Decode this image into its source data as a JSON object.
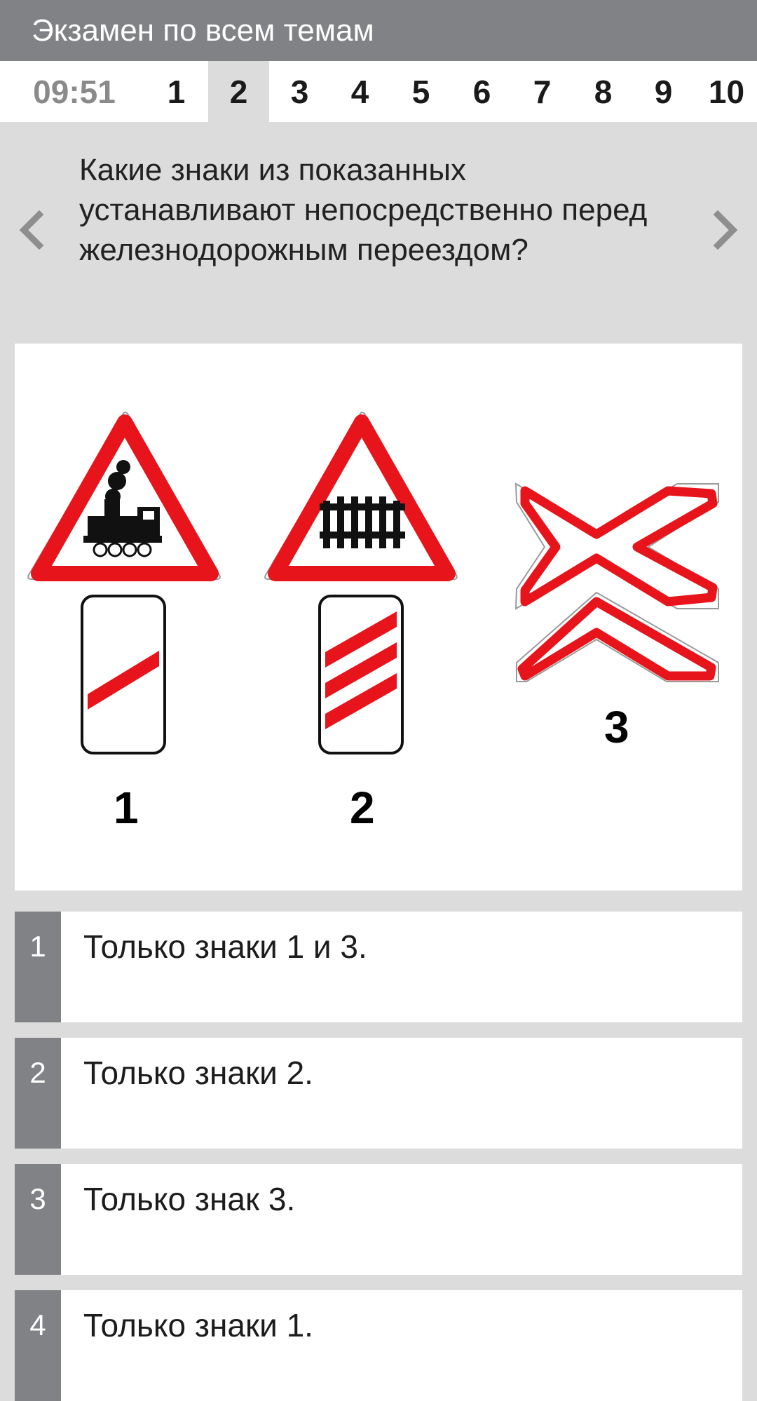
{
  "app_bar": {
    "title": "Экзамен по всем темам"
  },
  "tab_bar": {
    "timer": "09:51",
    "active_index": 1,
    "tabs": [
      "1",
      "2",
      "3",
      "4",
      "5",
      "6",
      "7",
      "8",
      "9",
      "10"
    ]
  },
  "question": {
    "text": "Какие знаки из показанных устанавливают непосредственно перед железнодорожным переездом?"
  },
  "image": {
    "signs": [
      {
        "label": "1",
        "icon": "train-warning-sign-with-one-stripe-beacon"
      },
      {
        "label": "2",
        "icon": "barrier-warning-sign-with-three-stripe-beacon"
      },
      {
        "label": "3",
        "icon": "multi-track-railway-crossing-sign"
      }
    ],
    "colors": {
      "red": "#e8141b",
      "black": "#111111"
    }
  },
  "answers": [
    {
      "num": "1",
      "text": "Только знаки 1 и 3."
    },
    {
      "num": "2",
      "text": "Только знаки 2."
    },
    {
      "num": "3",
      "text": "Только знак 3."
    },
    {
      "num": "4",
      "text": "Только знаки 1."
    }
  ],
  "icons": {
    "prev": "chevron-left-icon",
    "next": "chevron-right-icon"
  }
}
